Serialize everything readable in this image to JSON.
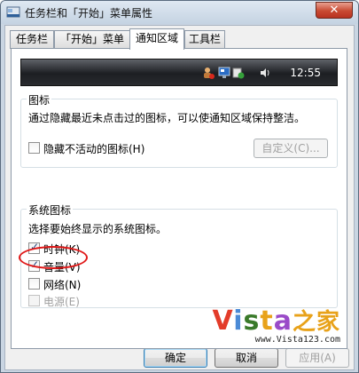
{
  "window": {
    "title": "任务栏和「开始」菜单属性",
    "close_label": "✕"
  },
  "tabs": [
    {
      "label": "任务栏"
    },
    {
      "label": "「开始」菜单"
    },
    {
      "label": "通知区域",
      "active": true
    },
    {
      "label": "工具栏"
    }
  ],
  "preview": {
    "clock": "12:55",
    "icons": [
      "user-error-icon",
      "network-icon",
      "security-check-icon",
      "volume-icon"
    ]
  },
  "icons_group": {
    "title": "图标",
    "description": "通过隐藏最近未点击过的图标，可以使通知区域保持整洁。",
    "hide_inactive_label": "隐藏不活动的图标(H)",
    "hide_inactive_checked": false,
    "customize_label": "自定义(C)..."
  },
  "system_icons_group": {
    "title": "系统图标",
    "description": "选择要始终显示的系统图标。",
    "items": [
      {
        "label": "时钟(K)",
        "checked": true,
        "enabled": true
      },
      {
        "label": "音量(V)",
        "checked": true,
        "enabled": true
      },
      {
        "label": "网络(N)",
        "checked": false,
        "enabled": true
      },
      {
        "label": "电源(E)",
        "checked": false,
        "enabled": false
      }
    ]
  },
  "footer": {
    "ok_label": "确定",
    "cancel_label": "取消",
    "apply_label": "应用(A)"
  },
  "watermark": {
    "logo_v": "V",
    "logo_i": "i",
    "logo_s": "s",
    "logo_t": "t",
    "logo_a": "a",
    "logo_home": "之家",
    "url": "www.Vista123.com"
  },
  "colors": {
    "highlight_ellipse": "#e01818"
  }
}
